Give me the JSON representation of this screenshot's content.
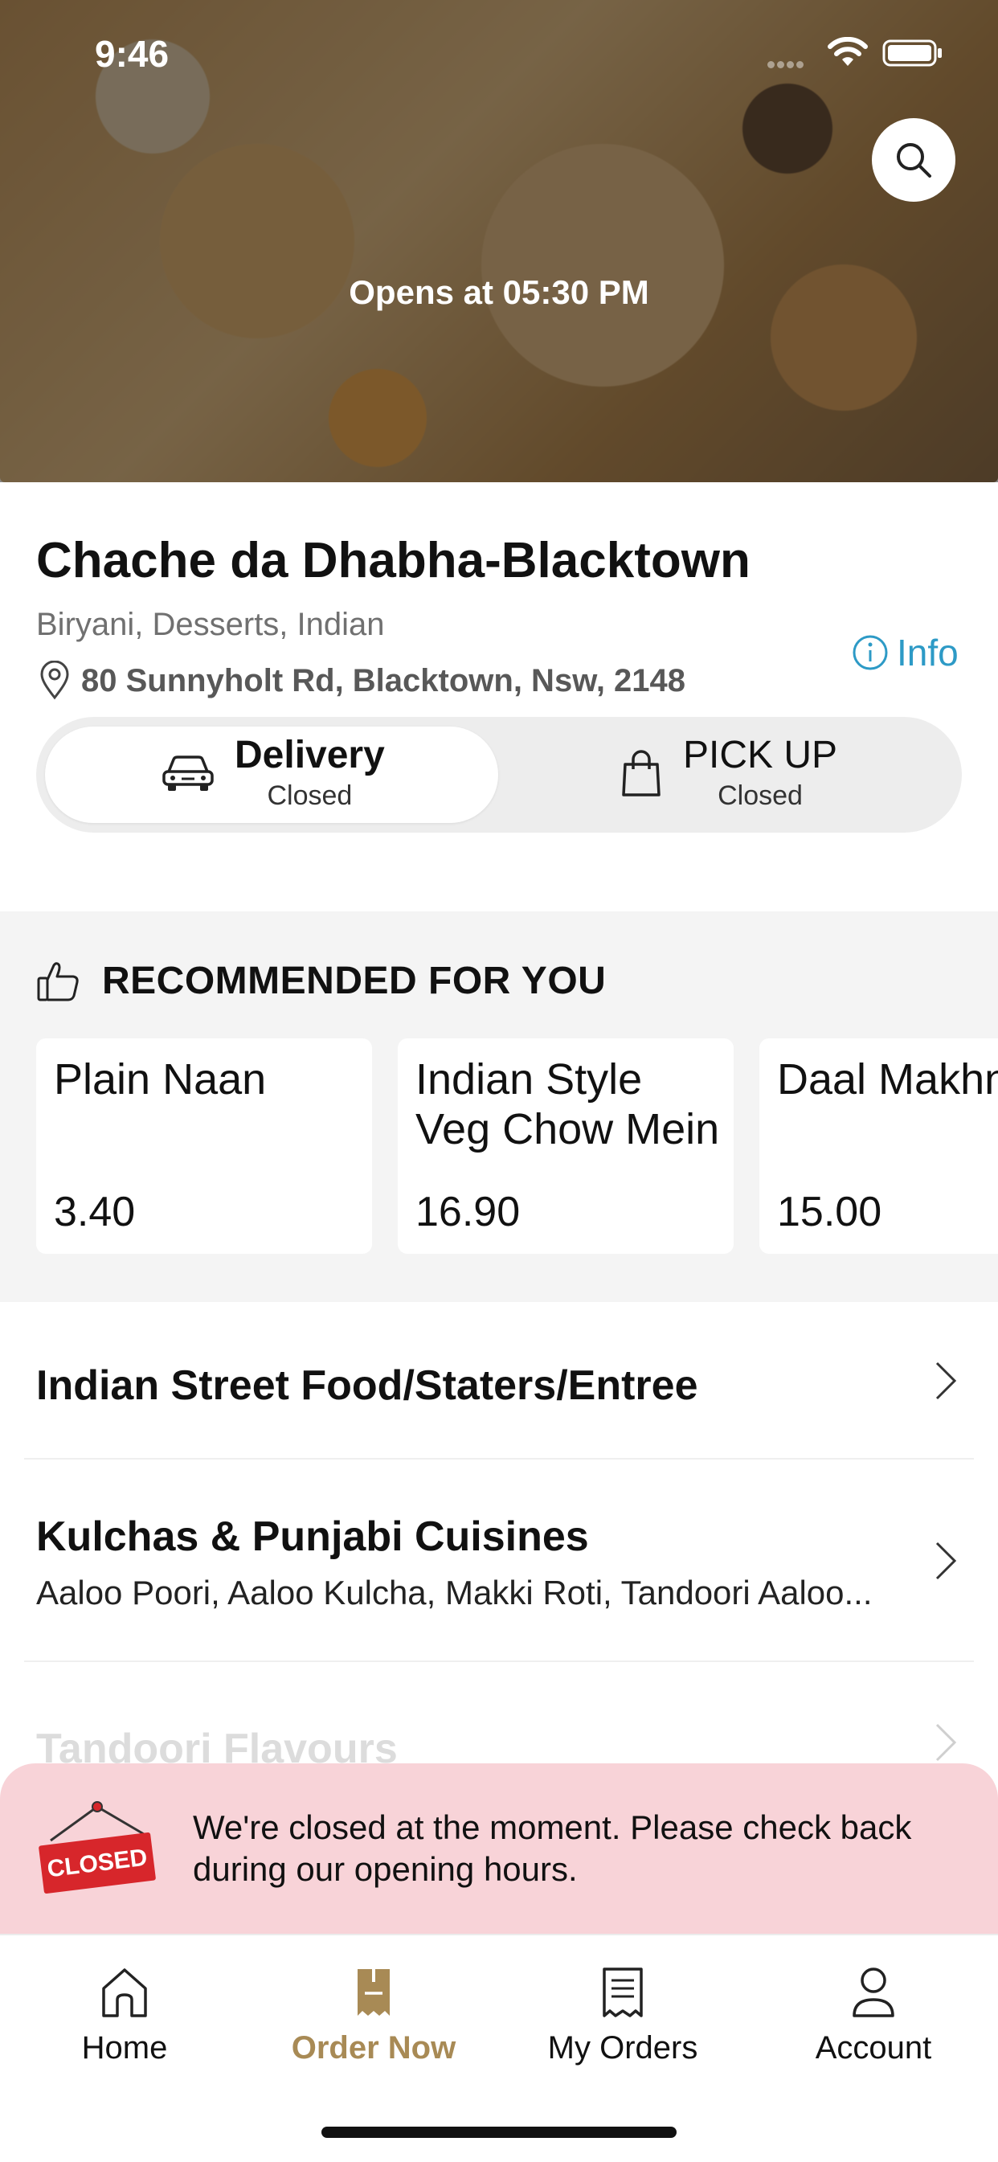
{
  "status_bar": {
    "time": "9:46"
  },
  "hero": {
    "opens_text": "Opens at 05:30 PM"
  },
  "restaurant": {
    "name": "Chache da Dhabha-Blacktown",
    "cuisines": "Biryani, Desserts, Indian",
    "address": "80 Sunnyholt Rd, Blacktown, Nsw, 2148",
    "info_label": "Info"
  },
  "modes": {
    "delivery": {
      "label": "Delivery",
      "status": "Closed"
    },
    "pickup": {
      "label": "PICK UP",
      "status": "Closed"
    }
  },
  "recommended": {
    "title": "RECOMMENDED FOR YOU",
    "items": [
      {
        "name": "Plain Naan",
        "price": "3.40"
      },
      {
        "name": "Indian Style Veg Chow Mein",
        "price": "16.90"
      },
      {
        "name": "Daal Makhni",
        "price": "15.00"
      }
    ]
  },
  "categories": [
    {
      "title": "Indian Street Food/Staters/Entree",
      "subtitle": ""
    },
    {
      "title": "Kulchas & Punjabi Cuisines",
      "subtitle": "Aaloo Poori, Aaloo Kulcha, Makki Roti, Tandoori Aaloo..."
    },
    {
      "title": "Tandoori Flavours",
      "subtitle": ""
    }
  ],
  "closed_banner": {
    "sign_text": "CLOSED",
    "message": "We're closed at the moment. Please check back during our opening hours."
  },
  "tabbar": {
    "tabs": [
      {
        "label": "Home",
        "icon": "home-icon"
      },
      {
        "label": "Order Now",
        "icon": "order-icon",
        "active": true
      },
      {
        "label": "My Orders",
        "icon": "receipt-icon"
      },
      {
        "label": "Account",
        "icon": "person-icon"
      }
    ]
  },
  "colors": {
    "accent": "#a88a55",
    "info": "#2d9ac6",
    "banner_bg": "#f8d3d8",
    "closed_red": "#d7262b"
  }
}
